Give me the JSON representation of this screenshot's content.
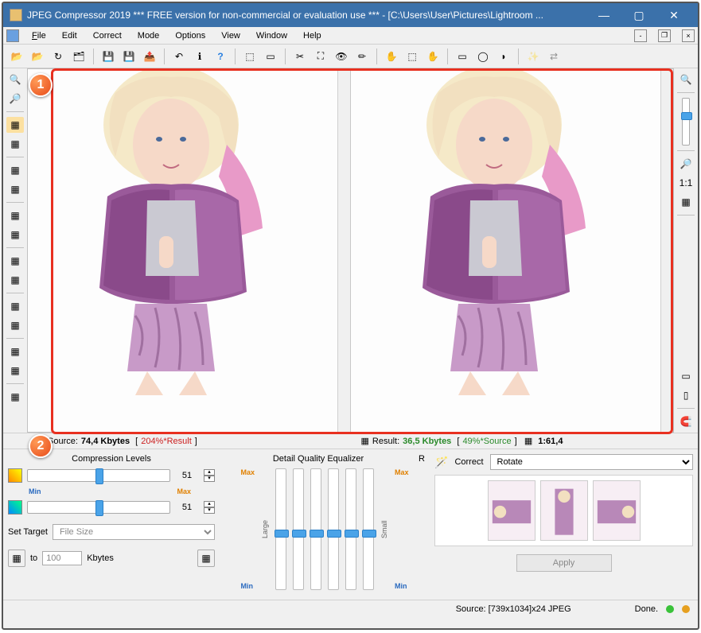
{
  "title": "JPEG Compressor 2019    *** FREE version for non-commercial or evaluation use *** - [C:\\Users\\User\\Pictures\\Lightroom ...",
  "menu": {
    "file": "File",
    "edit": "Edit",
    "correct": "Correct",
    "mode": "Mode",
    "options": "Options",
    "view": "View",
    "window": "Window",
    "help": "Help"
  },
  "info": {
    "source_label": "Source:",
    "source_size": "74,4 Kbytes",
    "source_pct": "204%*Result",
    "result_label": "Result:",
    "result_size": "36,5 Kbytes",
    "result_pct": "49%*Source",
    "ratio": "1:61,4"
  },
  "compression": {
    "title": "Compression Levels",
    "min": "Min",
    "max": "Max",
    "slider1": "51",
    "slider2": "51",
    "set_target": "Set Target",
    "target_mode": "File Size",
    "to": "to",
    "target_val": "100",
    "unit": "Kbytes"
  },
  "equalizer": {
    "title": "Detail Quality Equalizer",
    "r": "R",
    "large": "Large",
    "small": "Small",
    "max": "Max",
    "min": "Min"
  },
  "correct": {
    "label": "Correct",
    "dropdown": "Rotate",
    "apply": "Apply"
  },
  "status": {
    "source": "Source: [739x1034]x24 JPEG",
    "done": "Done."
  },
  "callouts": {
    "c1": "1",
    "c2": "2"
  }
}
